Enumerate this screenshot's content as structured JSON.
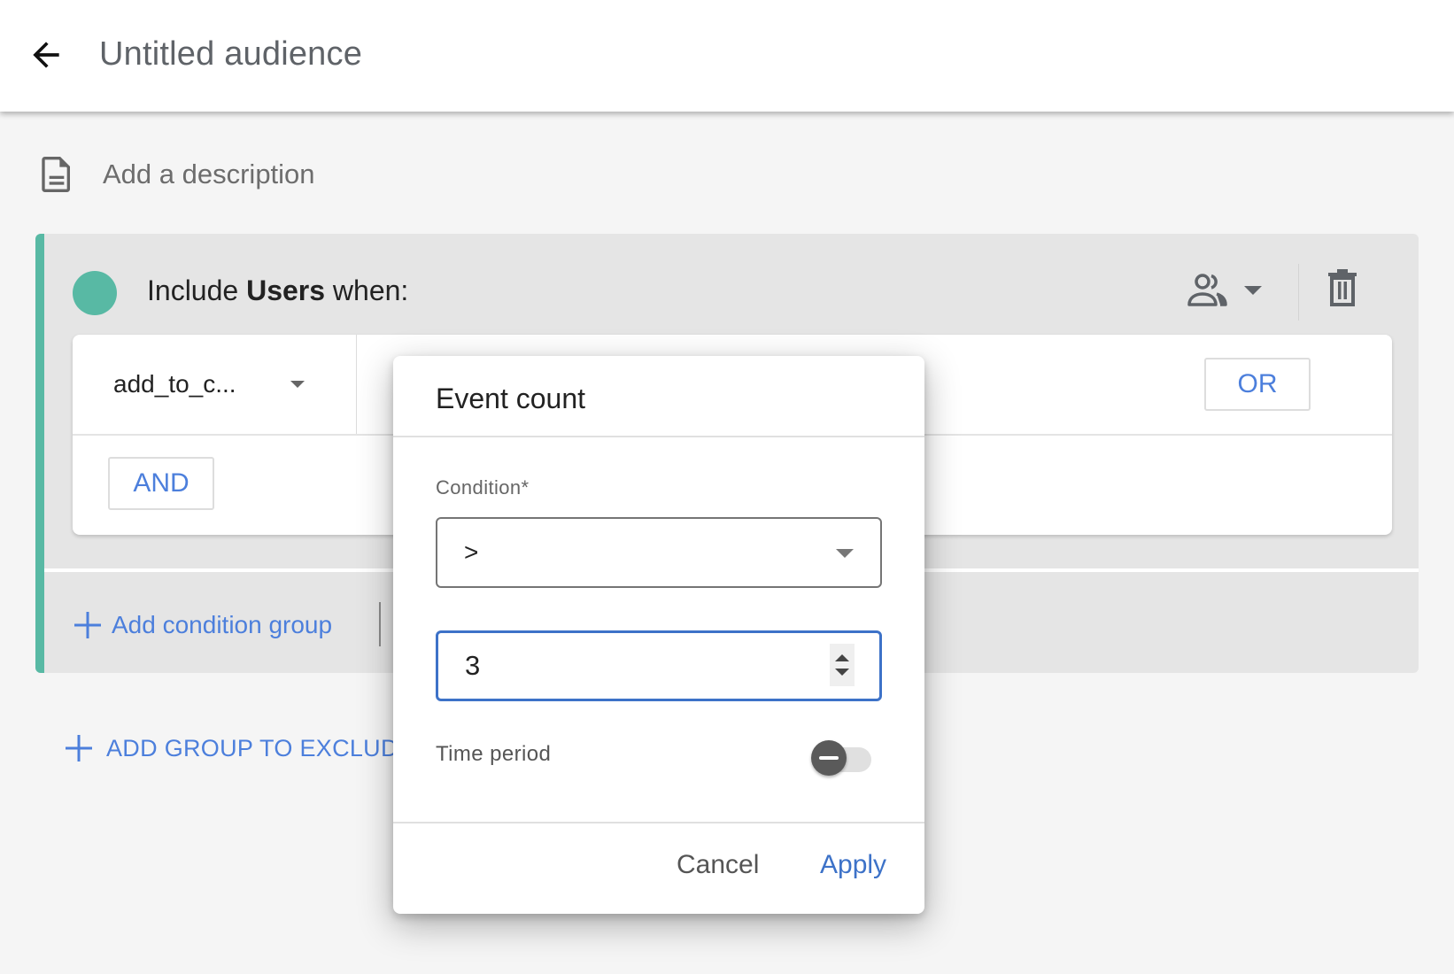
{
  "header": {
    "back_icon": "arrow-back-icon",
    "title": "Untitled audience"
  },
  "description": {
    "icon": "document-icon",
    "placeholder": "Add a description"
  },
  "include_group": {
    "accent_color": "#58b9a4",
    "prefix": "Include ",
    "scope": "Users",
    "suffix": " when:",
    "scope_icon": "people-icon",
    "delete_icon": "trash-icon",
    "condition": {
      "event_name": "add_to_c...",
      "or_label": "OR",
      "and_label": "AND"
    },
    "add_condition_group_label": "Add condition group"
  },
  "add_exclude_label": "ADD GROUP TO EXCLUDE",
  "dialog": {
    "title": "Event count",
    "condition_label": "Condition*",
    "condition_value": ">",
    "count_value": "3",
    "time_period_label": "Time period",
    "time_period_enabled": false,
    "cancel_label": "Cancel",
    "apply_label": "Apply"
  },
  "colors": {
    "accent_teal": "#58b9a4",
    "link_blue": "#4c7fdc",
    "focus_blue": "#3d72c8"
  }
}
